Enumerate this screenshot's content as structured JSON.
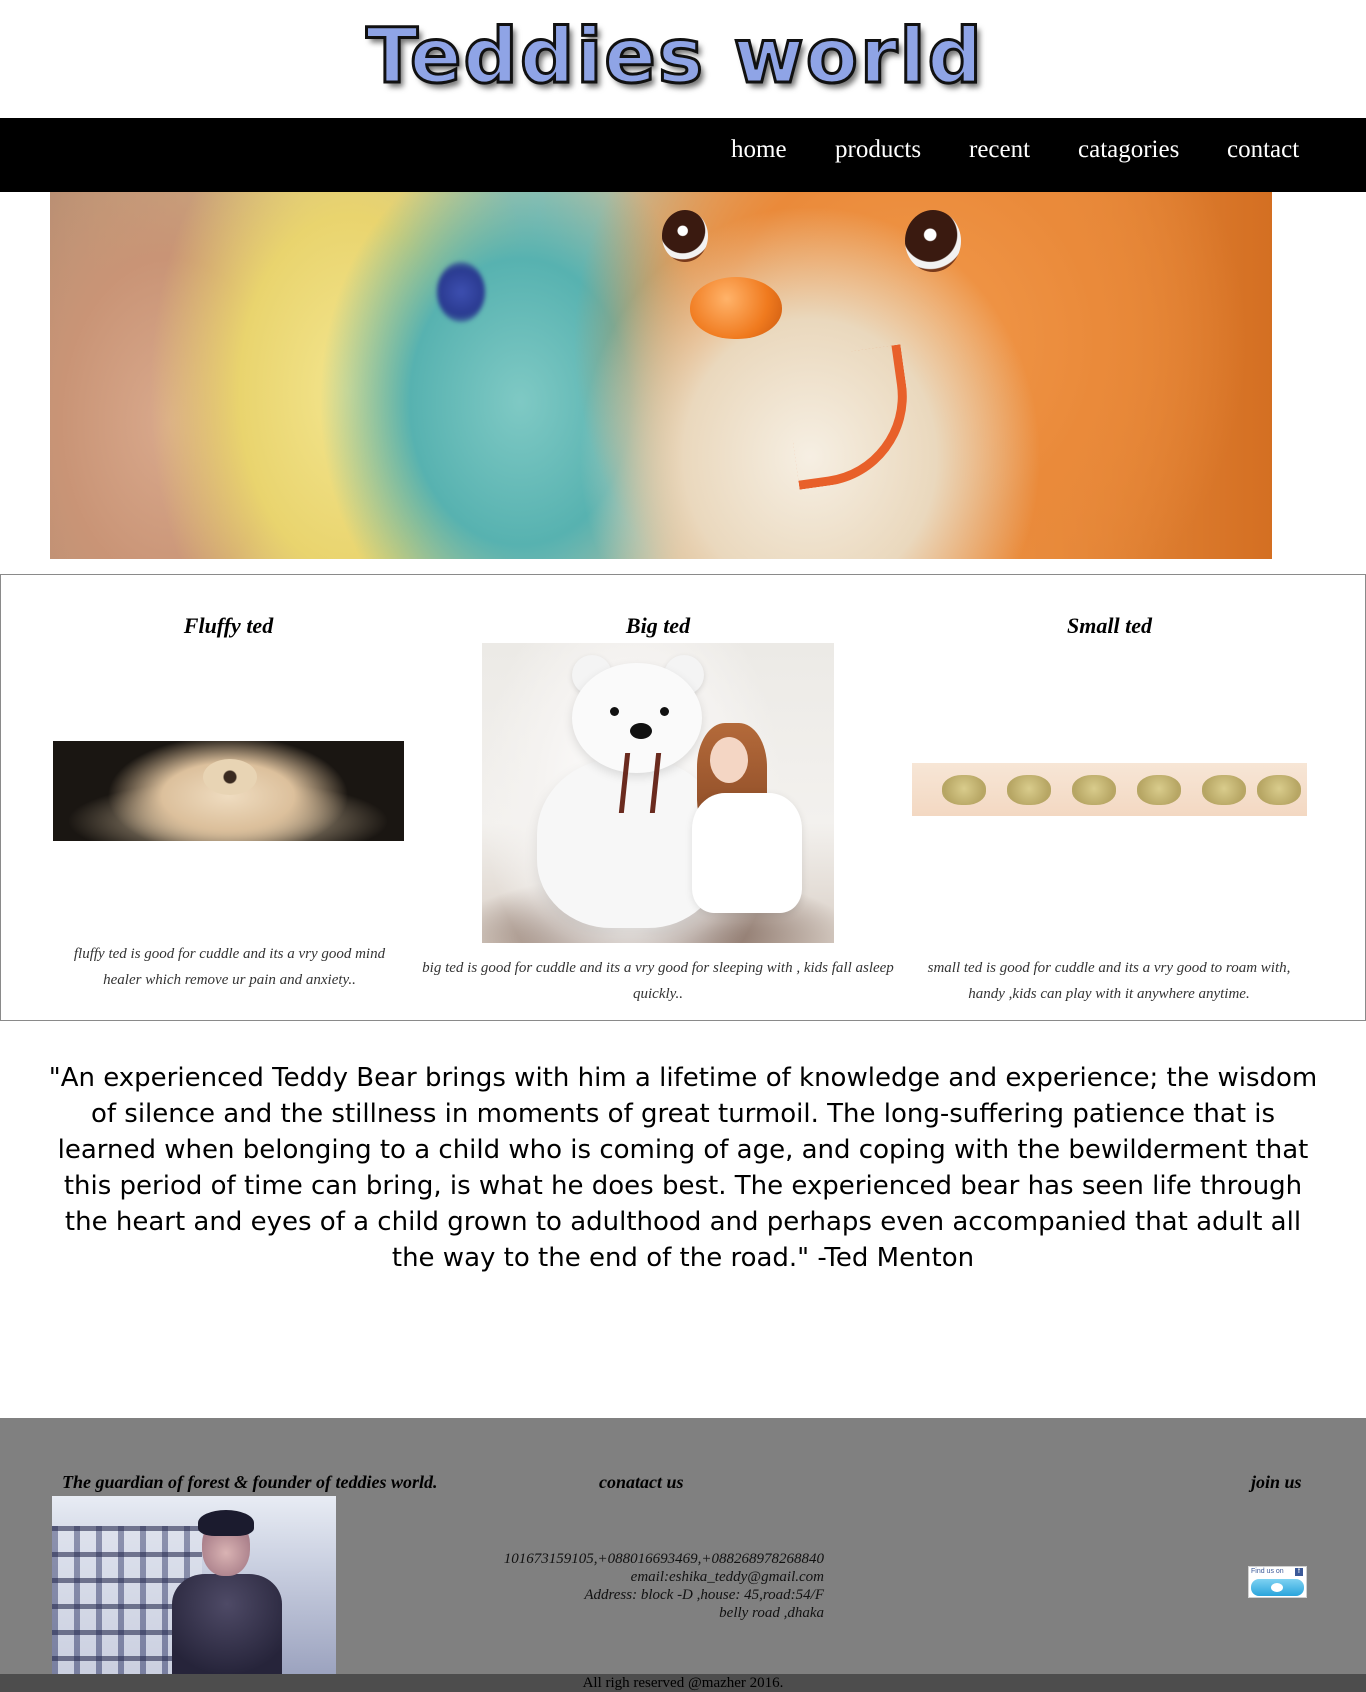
{
  "header": {
    "logo_text": "Teddies world"
  },
  "nav": {
    "items": [
      {
        "label": "home"
      },
      {
        "label": "products"
      },
      {
        "label": "recent"
      },
      {
        "label": "catagories"
      },
      {
        "label": "contact"
      }
    ]
  },
  "products": [
    {
      "title": "Fluffy ted",
      "description": "fluffy ted is good for cuddle and its a vry good mind healer which remove ur pain and anxiety.."
    },
    {
      "title": "Big ted",
      "description": "big ted is good for cuddle and its a vry good for sleeping with , kids fall asleep quickly.."
    },
    {
      "title": "Small ted",
      "description": "small ted is good for cuddle and its a vry good to roam with, handy ,kids can play with it anywhere anytime."
    }
  ],
  "quote": {
    "text": "\"An experienced Teddy Bear brings with him a lifetime of knowledge and experience; the wisdom of silence and the stillness in moments of great turmoil. The long-suffering patience that is learned when belonging to a child who is coming of age, and coping with the bewilderment that this period of time can bring, is what he does best. The experienced bear has seen life through the heart and eyes of a child grown to adulthood and perhaps even accompanied that adult all the way to the end of the road.\" -Ted Menton"
  },
  "footer": {
    "founder_heading": "The guardian of forest & founder of teddies world.",
    "contact_heading": "conatact us",
    "join_heading": "join us",
    "contact_lines": [
      "101673159105,+088016693469,+088268978268840",
      "email:eshika_teddy@gmail.com",
      "Address: block -D ,house: 45,road:54/F",
      "belly road ,dhaka"
    ],
    "facebook_badge": {
      "text": "Find us on",
      "icon": "facebook-icon"
    },
    "copyright": "All righ reserved @mazher 2016."
  },
  "colors": {
    "nav_background": "#000000",
    "nav_text": "#ffffff",
    "footer_background": "#808080",
    "bottom_bar": "#4d4d4d",
    "logo_fill": "#8fa4e6"
  }
}
